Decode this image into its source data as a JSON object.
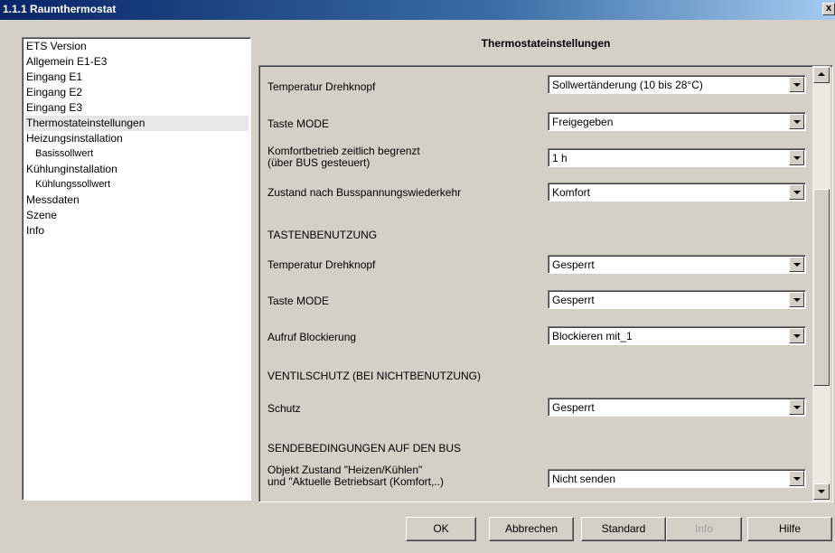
{
  "window": {
    "title": "1.1.1 Raumthermostat",
    "close_label": "x"
  },
  "tree": {
    "items": [
      {
        "label": "ETS Version",
        "level": 0,
        "selected": false
      },
      {
        "label": "Allgemein E1-E3",
        "level": 0,
        "selected": false
      },
      {
        "label": "Eingang E1",
        "level": 0,
        "selected": false
      },
      {
        "label": "Eingang E2",
        "level": 0,
        "selected": false
      },
      {
        "label": "Eingang E3",
        "level": 0,
        "selected": false
      },
      {
        "label": "Thermostateinstellungen",
        "level": 0,
        "selected": true
      },
      {
        "label": "Heizungsinstallation",
        "level": 0,
        "selected": false
      },
      {
        "label": "Basissollwert",
        "level": 1,
        "selected": false
      },
      {
        "label": "Kühlunginstallation",
        "level": 0,
        "selected": false
      },
      {
        "label": "Kühlungssollwert",
        "level": 1,
        "selected": false
      },
      {
        "label": "Messdaten",
        "level": 0,
        "selected": false
      },
      {
        "label": "Szene",
        "level": 0,
        "selected": false
      },
      {
        "label": "Info",
        "level": 0,
        "selected": false
      }
    ]
  },
  "settings": {
    "title": "Thermostateinstellungen",
    "rows": [
      {
        "label": "Temperatur Drehknopf",
        "value": "Sollwertänderung (10 bis 28°C)"
      },
      {
        "label": "Taste MODE",
        "value": "Freigegeben"
      },
      {
        "label": "Komfortbetrieb zeitlich begrenzt",
        "label2": "(über BUS gesteuert)",
        "value": "1 h"
      },
      {
        "label": "Zustand nach Busspannungswiederkehr",
        "value": "Komfort"
      },
      {
        "label": "Temperatur Drehknopf",
        "value": "Gesperrt"
      },
      {
        "label": "Taste MODE",
        "value": "Gesperrt"
      },
      {
        "label": "Aufruf Blockierung",
        "value": "Blockieren mit_1"
      },
      {
        "label": "Schutz",
        "value": "Gesperrt"
      },
      {
        "label": "Objekt Zustand \"Heizen/Kühlen\"",
        "label2": "und \"Aktuelle Betriebsart (Komfort,..)",
        "value": "Nicht senden"
      }
    ],
    "headings": {
      "tastenbenutzung": "TASTENBENUTZUNG",
      "ventilschutz": "VENTILSCHUTZ (BEI NICHTBENUTZUNG)",
      "sendebedingungen": "SENDEBEDINGUNGEN AUF DEN BUS"
    },
    "scrollbar": {
      "position_fraction": 0.3
    }
  },
  "buttons": {
    "ok": "OK",
    "cancel": "Abbrechen",
    "standard": "Standard",
    "info": "Info",
    "help": "Hilfe"
  },
  "colors": {
    "dialog_bg": "#d4d0c8",
    "titlebar_start": "#0a246a",
    "titlebar_end": "#a6caf0",
    "selected_item": "#e8e8e8"
  }
}
